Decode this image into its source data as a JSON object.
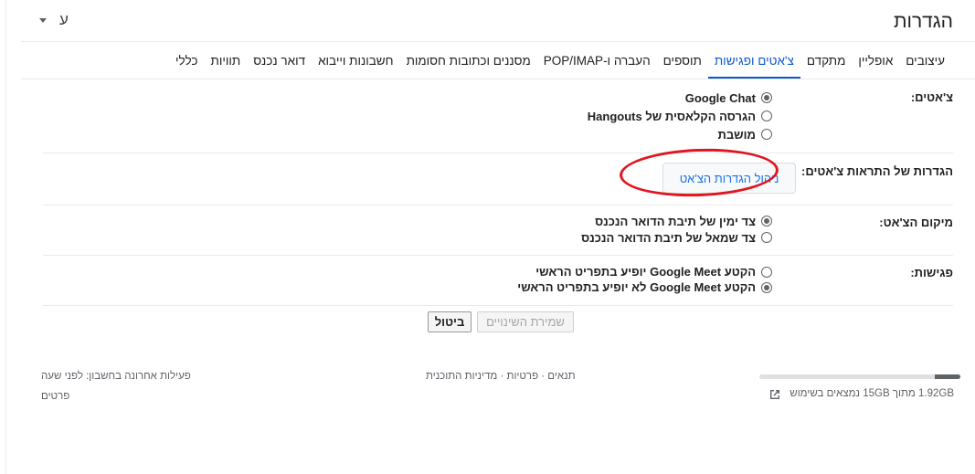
{
  "header": {
    "title": "הגדרות",
    "lang_label": "ע"
  },
  "tabs": [
    {
      "label": "כללי",
      "active": false
    },
    {
      "label": "תוויות",
      "active": false
    },
    {
      "label": "דואר נכנס",
      "active": false
    },
    {
      "label": "חשבונות וייבוא",
      "active": false
    },
    {
      "label": "מסננים וכתובות חסומות",
      "active": false
    },
    {
      "label": "העברה ו-POP/IMAP",
      "active": false
    },
    {
      "label": "תוספים",
      "active": false
    },
    {
      "label": "צ'אטים ופגישות",
      "active": true
    },
    {
      "label": "מתקדם",
      "active": false
    },
    {
      "label": "אופליין",
      "active": false
    },
    {
      "label": "עיצובים",
      "active": false
    }
  ],
  "chats": {
    "label": "צ'אטים:",
    "options": [
      {
        "label": "Google Chat",
        "checked": true
      },
      {
        "label": "הגרסה הקלאסית של Hangouts",
        "checked": false
      },
      {
        "label": "מושבת",
        "checked": false
      }
    ]
  },
  "chat_notifications": {
    "label": "הגדרות של התראות צ'אטים:",
    "button_label": "ניהול הגדרות הצ'אט"
  },
  "chat_position": {
    "label": "מיקום הצ'אט:",
    "options": [
      {
        "label": "צד ימין של תיבת הדואר הנכנס",
        "checked": true
      },
      {
        "label": "צד שמאל של תיבת הדואר הנכנס",
        "checked": false
      }
    ]
  },
  "meetings": {
    "label": "פגישות:",
    "options": [
      {
        "label": "הקטע Google Meet יופיע בתפריט הראשי",
        "checked": false
      },
      {
        "label": "הקטע Google Meet לא יופיע בתפריט הראשי",
        "checked": true
      }
    ]
  },
  "actions": {
    "save_label": "שמירת השינויים",
    "cancel_label": "ביטול"
  },
  "footer": {
    "storage_text": "1.92GB מתוך 15GB נמצאים בשימוש",
    "storage_used_fraction": 0.128,
    "links": "תנאים · פרטיות · מדיניות התוכנית",
    "last_activity": "פעילות אחרונה בחשבון: לפני שעה",
    "details_label": "פרטים"
  },
  "colors": {
    "accent": "#0b57d0",
    "annotation": "#e0151f"
  }
}
